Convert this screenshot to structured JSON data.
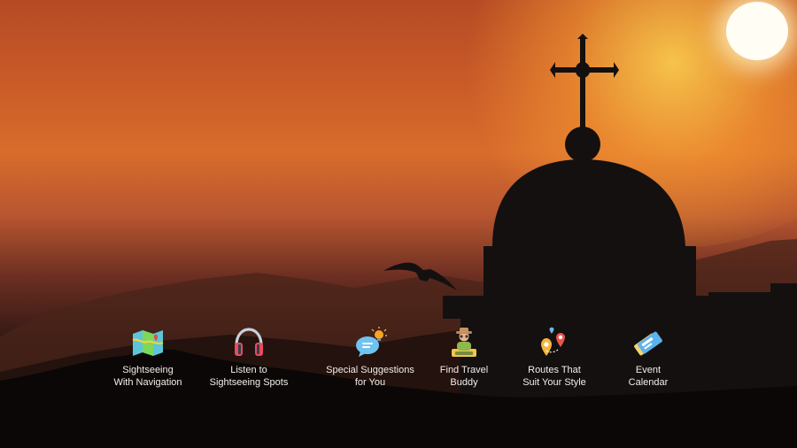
{
  "features": [
    {
      "icon": "map-icon",
      "label": "Sightseeing\nWith Navigation"
    },
    {
      "icon": "headphones-icon",
      "label": "Listen to\nSightseeing Spots"
    },
    {
      "icon": "chat-bubble-icon",
      "label": "Special Suggestions\nfor You"
    },
    {
      "icon": "traveler-icon",
      "label": "Find Travel\nBuddy"
    },
    {
      "icon": "route-pins-icon",
      "label": "Routes That\nSuit Your Style"
    },
    {
      "icon": "tickets-icon",
      "label": "Event\nCalendar"
    }
  ]
}
